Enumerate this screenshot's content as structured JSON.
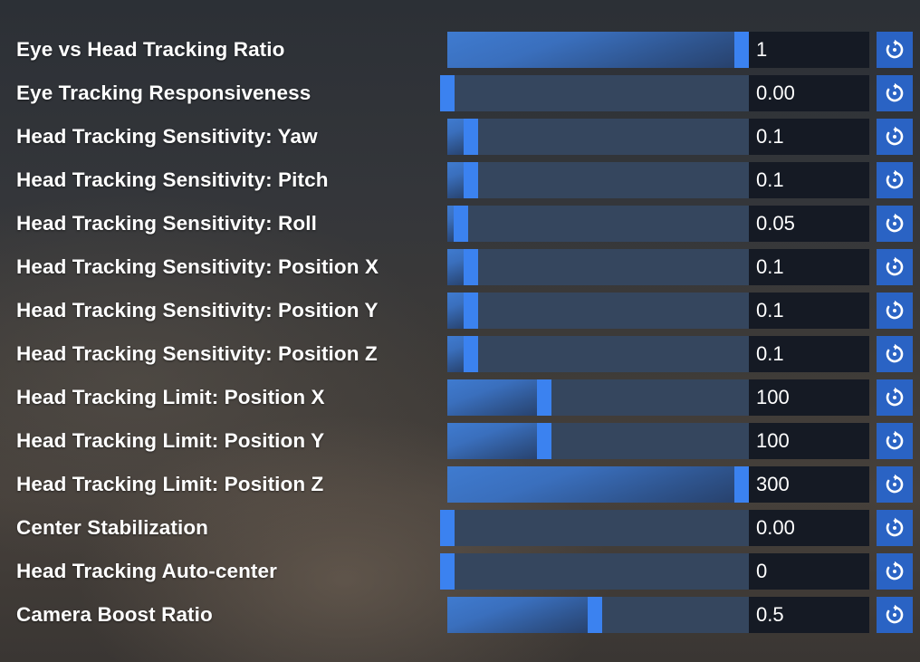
{
  "settings": [
    {
      "label": "Eye vs Head Tracking Ratio",
      "value": "1",
      "level": 1.0
    },
    {
      "label": "Eye Tracking Responsiveness",
      "value": "0.00",
      "level": 0.0
    },
    {
      "label": "Head Tracking Sensitivity: Yaw",
      "value": "0.1",
      "level": 0.08
    },
    {
      "label": "Head Tracking Sensitivity: Pitch",
      "value": "0.1",
      "level": 0.08
    },
    {
      "label": "Head Tracking Sensitivity: Roll",
      "value": "0.05",
      "level": 0.045
    },
    {
      "label": "Head Tracking Sensitivity: Position X",
      "value": "0.1",
      "level": 0.08
    },
    {
      "label": "Head Tracking Sensitivity: Position Y",
      "value": "0.1",
      "level": 0.08
    },
    {
      "label": "Head Tracking Sensitivity: Position Z",
      "value": "0.1",
      "level": 0.08
    },
    {
      "label": "Head Tracking Limit: Position X",
      "value": "100",
      "level": 0.33
    },
    {
      "label": "Head Tracking Limit: Position Y",
      "value": "100",
      "level": 0.33
    },
    {
      "label": "Head Tracking Limit: Position Z",
      "value": "300",
      "level": 1.0
    },
    {
      "label": "Center Stabilization",
      "value": "0.00",
      "level": 0.0
    },
    {
      "label": "Head Tracking Auto-center",
      "value": "0",
      "level": 0.0
    },
    {
      "label": "Camera Boost Ratio",
      "value": "0.5",
      "level": 0.5
    }
  ],
  "icons": {
    "reset": "reset-icon"
  },
  "colors": {
    "accent": "#3b82f0",
    "button": "#2a63c4",
    "track": "#35465e",
    "value_box": "#151a24"
  }
}
